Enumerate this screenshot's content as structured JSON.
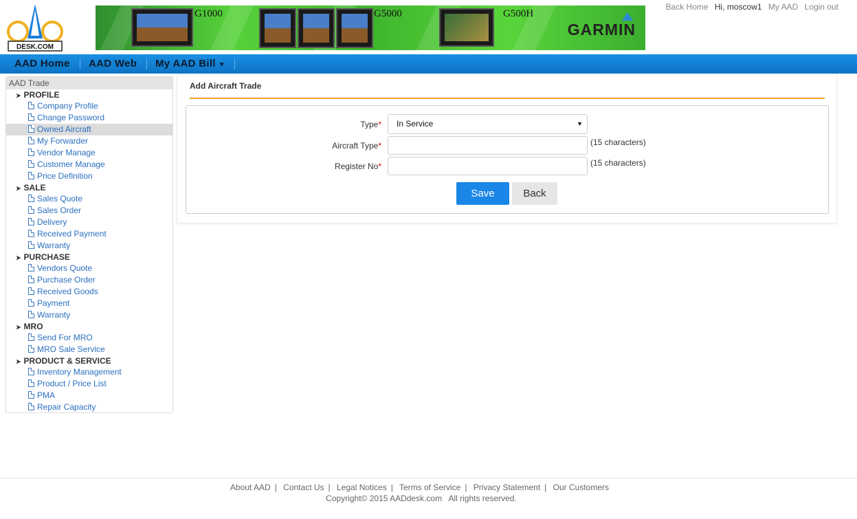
{
  "header": {
    "logo_text": "DESK.COM",
    "banner": {
      "models": [
        "G1000",
        "G5000",
        "G500H"
      ],
      "brand": "GARMIN"
    },
    "top_links": {
      "back_home": "Back Home",
      "greeting": "Hi, moscow1",
      "my_aad": "My AAD",
      "logout": "Login out"
    }
  },
  "nav": {
    "items": [
      "AAD Home",
      "AAD Web",
      "My AAD Bill"
    ]
  },
  "sidebar": {
    "header": "AAD Trade",
    "groups": [
      {
        "title": "PROFILE",
        "items": [
          "Company Profile",
          "Change Password",
          "Owned Aircraft",
          "My Forwarder",
          "Vendor Manage",
          "Customer Manage",
          "Price Definition"
        ]
      },
      {
        "title": "SALE",
        "items": [
          "Sales Quote",
          "Sales Order",
          "Delivery",
          "Received Payment",
          "Warranty"
        ]
      },
      {
        "title": "PURCHASE",
        "items": [
          "Vendors Quote",
          "Purchase Order",
          "Received Goods",
          "Payment",
          "Warranty"
        ]
      },
      {
        "title": "MRO",
        "items": [
          "Send For MRO",
          "MRO Sale Service"
        ]
      },
      {
        "title": "PRODUCT & SERVICE",
        "items": [
          "Inventory Management",
          "Product / Price List",
          "PMA",
          "Repair Capacity"
        ]
      }
    ],
    "active_item": "Owned Aircraft"
  },
  "form": {
    "title": "Add Aircraft Trade",
    "type_label": "Type",
    "type_value": "In Service",
    "aircraft_type_label": "Aircraft Type",
    "aircraft_type_value": "",
    "aircraft_type_hint": "(15 characters)",
    "register_no_label": "Register No",
    "register_no_value": "",
    "register_no_hint": "(15 characters)",
    "save_label": "Save",
    "back_label": "Back",
    "required_mark": "*"
  },
  "footer": {
    "links": [
      "About AAD",
      "Contact Us",
      "Legal Notices",
      "Terms of Service",
      "Privacy Statement",
      "Our Customers"
    ],
    "copyright": "Copyright© 2015 AADdesk.com   All rights reserved."
  },
  "colors": {
    "nav_blue": "#0d74c5",
    "link_blue": "#2a6fc0",
    "accent_orange": "#f0a020",
    "save_blue": "#1a86e8",
    "required_red": "#dd0000"
  }
}
